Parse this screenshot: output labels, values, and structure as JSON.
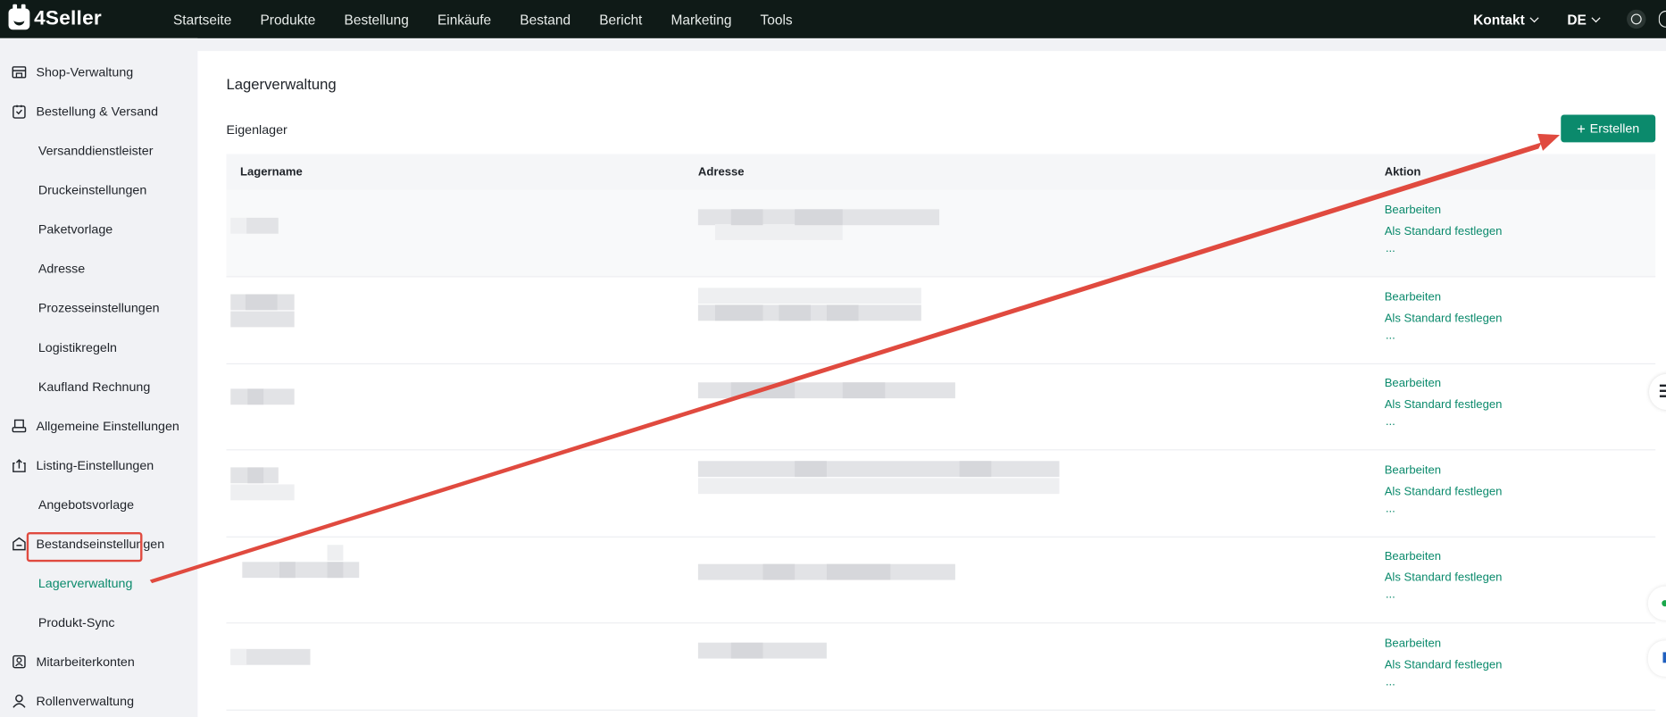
{
  "app": {
    "logo_text": "4Seller"
  },
  "nav": {
    "items": [
      "Startseite",
      "Produkte",
      "Bestellung",
      "Einkäufe",
      "Bestand",
      "Bericht",
      "Marketing",
      "Tools"
    ],
    "contact": "Kontakt",
    "language": "DE"
  },
  "sidebar": {
    "items": [
      {
        "label": "Shop-Verwaltung",
        "level": "top",
        "icon": "store-icon"
      },
      {
        "label": "Bestellung & Versand",
        "level": "top",
        "icon": "order-bag-icon"
      },
      {
        "label": "Versanddienstleister",
        "level": "sub"
      },
      {
        "label": "Druckeinstellungen",
        "level": "sub"
      },
      {
        "label": "Paketvorlage",
        "level": "sub"
      },
      {
        "label": "Adresse",
        "level": "sub"
      },
      {
        "label": "Prozesseinstellungen",
        "level": "sub"
      },
      {
        "label": "Logistikregeln",
        "level": "sub"
      },
      {
        "label": "Kaufland Rechnung",
        "level": "sub"
      },
      {
        "label": "Allgemeine Einstellungen",
        "level": "top",
        "icon": "printer-icon"
      },
      {
        "label": "Listing-Einstellungen",
        "level": "top",
        "icon": "upload-box-icon"
      },
      {
        "label": "Angebotsvorlage",
        "level": "sub"
      },
      {
        "label": "Bestandseinstellungen",
        "level": "top",
        "icon": "warehouse-icon"
      },
      {
        "label": "Lagerverwaltung",
        "level": "sub",
        "active": true
      },
      {
        "label": "Produkt-Sync",
        "level": "sub"
      },
      {
        "label": "Mitarbeiterkonten",
        "level": "top",
        "icon": "badge-icon"
      },
      {
        "label": "Rollenverwaltung",
        "level": "top",
        "icon": "user-icon"
      }
    ]
  },
  "main": {
    "page_title": "Lagerverwaltung",
    "section_label": "Eigenlager",
    "create_button": "Erstellen",
    "columns": [
      "Lagername",
      "Adresse",
      "Aktion"
    ],
    "row_actions": [
      "Bearbeiten",
      "Als Standard festlegen",
      "..."
    ],
    "row_count": 6
  },
  "colors": {
    "accent": "#0b8a6c",
    "annotation": "#e04a3f",
    "topbar": "#0f1a17"
  }
}
